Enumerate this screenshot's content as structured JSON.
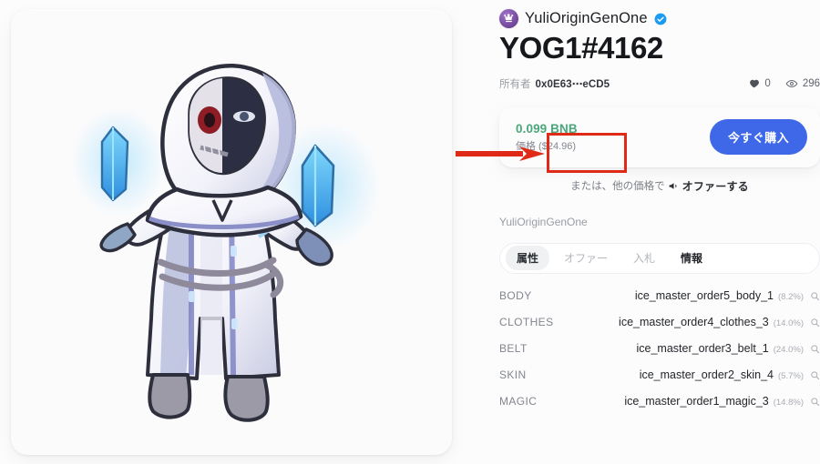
{
  "collection": {
    "name": "YuliOriginGenOne",
    "avatar_icon": "crown-emblem-icon",
    "verified_icon": "verified-badge-icon"
  },
  "nft": {
    "title": "YOG1#4162",
    "artwork_alt": "hooded-ice-mage-character"
  },
  "owner": {
    "label": "所有者",
    "address": "0x0E63⋯eCD5"
  },
  "stats": {
    "likes_icon": "heart-icon",
    "likes": "0",
    "views_icon": "eye-icon",
    "views": "296"
  },
  "price_card": {
    "price": "0.099 BNB",
    "price_sub": "価格 ($24.96)",
    "buy_label": "今すぐ購入",
    "price_color": "#4aa77a",
    "buy_color": "#3f68e8"
  },
  "offer": {
    "prefix": "または、他の価格で",
    "icon": "megaphone-icon",
    "link": "オファーする"
  },
  "collection_sub": "YuliOriginGenOne",
  "tabs": [
    {
      "label": "属性",
      "state": "active"
    },
    {
      "label": "オファー",
      "state": "muted"
    },
    {
      "label": "入札",
      "state": "muted"
    },
    {
      "label": "情報",
      "state": "strong"
    }
  ],
  "attributes": [
    {
      "key": "BODY",
      "value": "ice_master_order5_body_1",
      "pct": "(8.2%)",
      "icon": "search-icon"
    },
    {
      "key": "CLOTHES",
      "value": "ice_master_order4_clothes_3",
      "pct": "(14.0%)",
      "icon": "search-icon"
    },
    {
      "key": "BELT",
      "value": "ice_master_order3_belt_1",
      "pct": "(24.0%)",
      "icon": "search-icon"
    },
    {
      "key": "SKIN",
      "value": "ice_master_order2_skin_4",
      "pct": "(5.7%)",
      "icon": "search-icon"
    },
    {
      "key": "MAGIC",
      "value": "ice_master_order1_magic_3",
      "pct": "(14.8%)",
      "icon": "search-icon"
    }
  ],
  "annotation": {
    "highlight_color": "#e02a18",
    "arrow_icon": "red-arrow-pointing-right",
    "box_icon": "red-highlight-box"
  }
}
